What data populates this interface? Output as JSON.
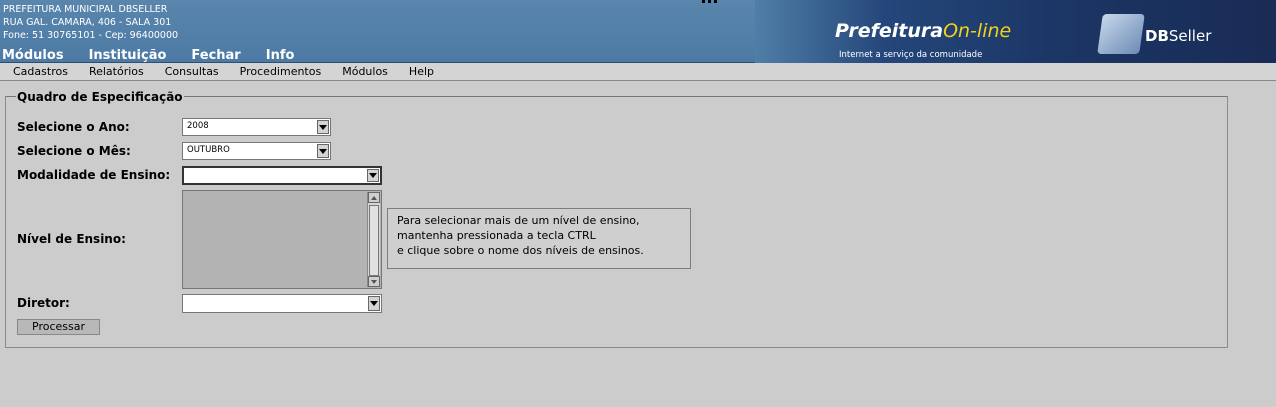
{
  "header": {
    "institution_lines": [
      "PREFEITURA MUNICIPAL DBSELLER",
      "RUA GAL. CAMARA, 406 - SALA 301",
      "Fone: 51 30765101  -  Cep: 96400000"
    ],
    "top_menu": [
      "Módulos",
      "Instituição",
      "Fechar",
      "Info"
    ],
    "brand_main": "Prefeitura",
    "brand_online": "On-line",
    "brand_tagline": "Internet a serviço da comunidade",
    "db_logo_bold": "DB",
    "db_logo_normal": "Seller"
  },
  "menubar": [
    "Cadastros",
    "Relatórios",
    "Consultas",
    "Procedimentos",
    "Módulos",
    "Help"
  ],
  "form": {
    "legend": "Quadro de Especificação",
    "ano_label": "Selecione o Ano:",
    "ano_value": "2008",
    "mes_label": "Selecione o Mês:",
    "mes_value": "OUTUBRO",
    "modalidade_label": "Modalidade de Ensino:",
    "modalidade_value": "",
    "nivel_label": "Nível de Ensino:",
    "hint_lines": [
      "Para selecionar mais de um nível de ensino,",
      "mantenha pressionada a tecla CTRL",
      "e clique sobre o nome dos níveis de ensinos."
    ],
    "diretor_label": "Diretor:",
    "diretor_value": "",
    "processar_label": "Processar"
  }
}
